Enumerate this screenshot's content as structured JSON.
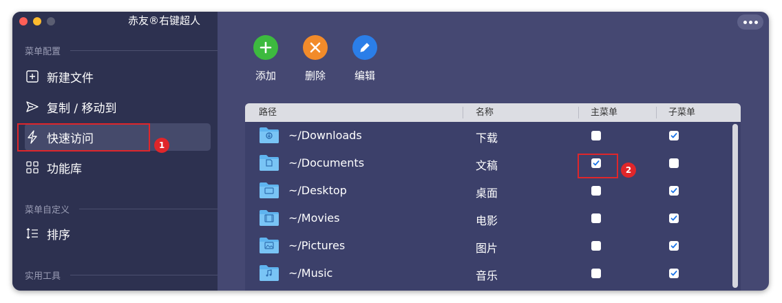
{
  "app": {
    "title": "赤友®右键超人"
  },
  "sidebar": {
    "sections": [
      {
        "label": "菜单配置"
      },
      {
        "label": "菜单自定义"
      },
      {
        "label": "实用工具"
      }
    ],
    "items": [
      {
        "label": "新建文件",
        "icon": "new-file-icon"
      },
      {
        "label": "复制 / 移动到",
        "icon": "send-icon"
      },
      {
        "label": "快速访问",
        "icon": "lightning-icon",
        "active": true
      },
      {
        "label": "功能库",
        "icon": "grid-icon"
      },
      {
        "label": "排序",
        "icon": "sort-icon"
      }
    ]
  },
  "annotations": {
    "badge1": "1",
    "badge2": "2"
  },
  "toolbar": {
    "add_label": "添加",
    "delete_label": "删除",
    "edit_label": "编辑",
    "colors": {
      "add": "#3dba3f",
      "delete": "#f28b2a",
      "edit": "#2b7ee8"
    }
  },
  "table": {
    "columns": {
      "path": "路径",
      "name": "名称",
      "main_menu": "主菜单",
      "sub_menu": "子菜单"
    },
    "rows": [
      {
        "path": "~/Downloads",
        "name": "下载",
        "main": false,
        "sub": true,
        "icon": "downloads-folder-icon"
      },
      {
        "path": "~/Documents",
        "name": "文稿",
        "main": true,
        "sub": false,
        "icon": "documents-folder-icon"
      },
      {
        "path": "~/Desktop",
        "name": "桌面",
        "main": false,
        "sub": true,
        "icon": "desktop-folder-icon"
      },
      {
        "path": "~/Movies",
        "name": "电影",
        "main": false,
        "sub": true,
        "icon": "movies-folder-icon"
      },
      {
        "path": "~/Pictures",
        "name": "图片",
        "main": false,
        "sub": true,
        "icon": "pictures-folder-icon"
      },
      {
        "path": "~/Music",
        "name": "音乐",
        "main": false,
        "sub": true,
        "icon": "music-folder-icon"
      }
    ]
  }
}
